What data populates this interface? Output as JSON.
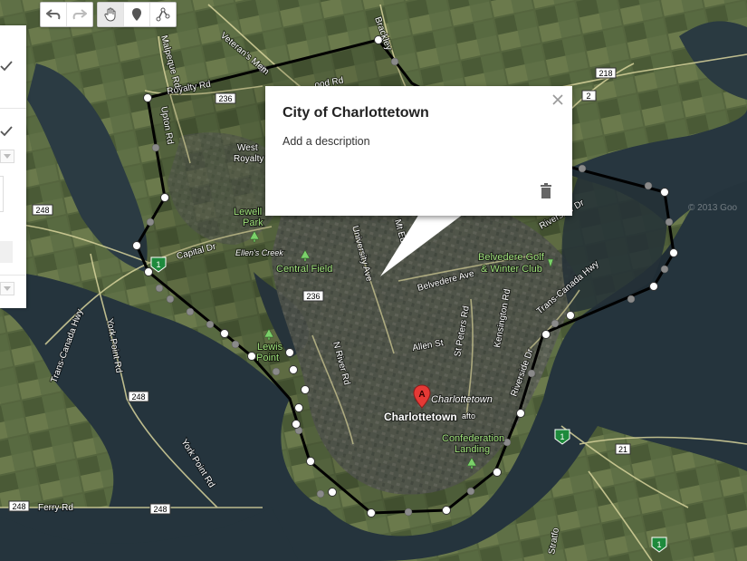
{
  "toolbar": {
    "buttons": [
      "undo-icon",
      "redo-icon",
      "hand-pan-icon",
      "add-marker-icon",
      "draw-line-icon"
    ]
  },
  "popup": {
    "title": "City of Charlottetown",
    "description_placeholder": "Add a description"
  },
  "map_labels": {
    "royalty_rd": "Royalty Rd",
    "malpeque_rd": "Malpeque Rd",
    "upton_rd": "Upton Rd",
    "veterans_mem": "Veteran's Mem",
    "brackley": "Brackley",
    "wood_rd": "ood Rd",
    "west_royalty_1": "West",
    "west_royalty_2": "Royalty",
    "lewellyn_park_1": "Lewell",
    "lewellyn_park_2": "Park",
    "ellens_creek": "Ellen's Creek",
    "capital_dr": "Capital Dr",
    "central_field": "Central Field",
    "university_ave": "University Ave",
    "mt_edward": "Mt Ed",
    "belvedere_ave": "Belvedere Ave",
    "belvedere_golf_1": "Belvedere Golf",
    "belvedere_golf_2": "& Winter Club",
    "riverside_dr": "Riverside Dr",
    "trans_canada_hwy_1": "Trans-Canada Hwy",
    "trans_canada_hwy_2": "Trans-Canada Hwy",
    "york_point_rd_1": "York Point Rd",
    "york_point_rd_2": "York Point Rd",
    "ferry_rd": "Ferry Rd",
    "lewis_point_1": "Lewis",
    "lewis_point_2": "Point",
    "n_river_rd": "N River Rd",
    "allen_st": "Allen St",
    "st_peters_rd": "St Peters Rd",
    "kensington_rd": "Kensington Rd",
    "riverside_dr_2": "Riverside Dr",
    "charlottetown_marker": "Charlottetown",
    "charlottetown_city": "Charlottetown",
    "confederation_1": "Confederation",
    "confederation_2": "Landing",
    "grafton": "afto",
    "stratford": "Stratfo",
    "copyright": "© 2013 Goo",
    "marker_letter": "A"
  },
  "shields": {
    "s236a": "236",
    "s236b": "236",
    "s248a": "248",
    "s248b": "248",
    "s248c": "248",
    "s248d": "248",
    "s218": "218",
    "s2": "2",
    "s21": "21",
    "s1a": "1",
    "s1b": "1",
    "s1c": "1"
  },
  "colors": {
    "boundary": "#000000",
    "vertex": "#ffffff",
    "midpoint": "#8a8a8a",
    "marker": "#e53935",
    "water": "#23333d",
    "land": "#4d5c3b"
  }
}
